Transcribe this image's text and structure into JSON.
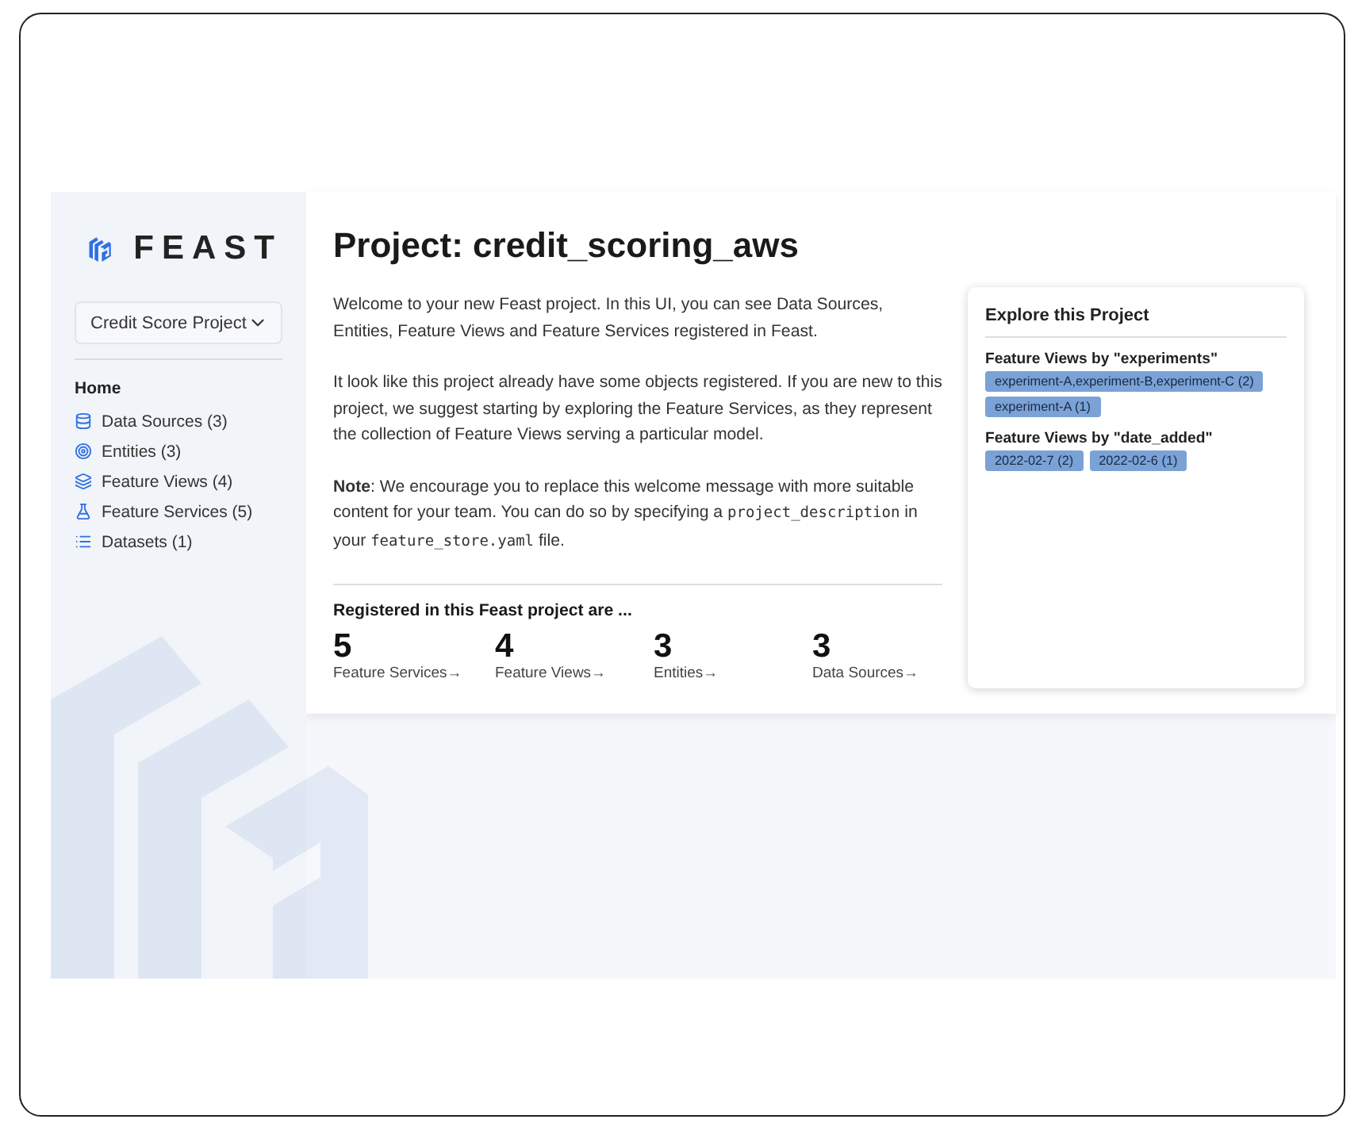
{
  "sidebar": {
    "brand": "FEAST",
    "project_select": {
      "value": "Credit Score Project"
    },
    "heading": "Home",
    "items": [
      {
        "label": "Data Sources (3)"
      },
      {
        "label": "Entities (3)"
      },
      {
        "label": "Feature Views (4)"
      },
      {
        "label": "Feature Services (5)"
      },
      {
        "label": "Datasets (1)"
      }
    ]
  },
  "main": {
    "title": "Project: credit_scoring_aws",
    "paragraphs": [
      [
        {
          "kind": "text",
          "text": "Welcome to your new Feast project. In this UI, you can see Data Sources, Entities, Feature Views and Feature Services registered in Feast."
        }
      ],
      [
        {
          "kind": "text",
          "text": "It look like this project already have some objects registered. If you are new to this project, we suggest starting by exploring the Feature Services, as they represent the collection of Feature Views serving a particular model."
        }
      ],
      [
        {
          "kind": "bold",
          "text": "Note"
        },
        {
          "kind": "text",
          "text": ": We encourage you to replace this welcome message with more suitable content for your team. You can do so by specifying a "
        },
        {
          "kind": "code",
          "text": "project_description"
        },
        {
          "kind": "text",
          "text": " in your "
        },
        {
          "kind": "code",
          "text": "feature_store.yaml"
        },
        {
          "kind": "text",
          "text": " file."
        }
      ]
    ],
    "registered_heading": "Registered in this Feast project are ...",
    "stats": [
      {
        "value": "5",
        "label": "Feature Services→"
      },
      {
        "value": "4",
        "label": "Feature Views→"
      },
      {
        "value": "3",
        "label": "Entities→"
      },
      {
        "value": "3",
        "label": "Data Sources→"
      }
    ]
  },
  "explore": {
    "title": "Explore this Project",
    "groups": [
      {
        "title": "Feature Views by \"experiments\"",
        "tags": [
          "experiment-A,experiment-B,experiment-C (2)",
          "experiment-A (1)"
        ]
      },
      {
        "title": "Feature Views by \"date_added\"",
        "tags": [
          "2022-02-7 (2)",
          "2022-02-6 (1)"
        ]
      }
    ]
  }
}
